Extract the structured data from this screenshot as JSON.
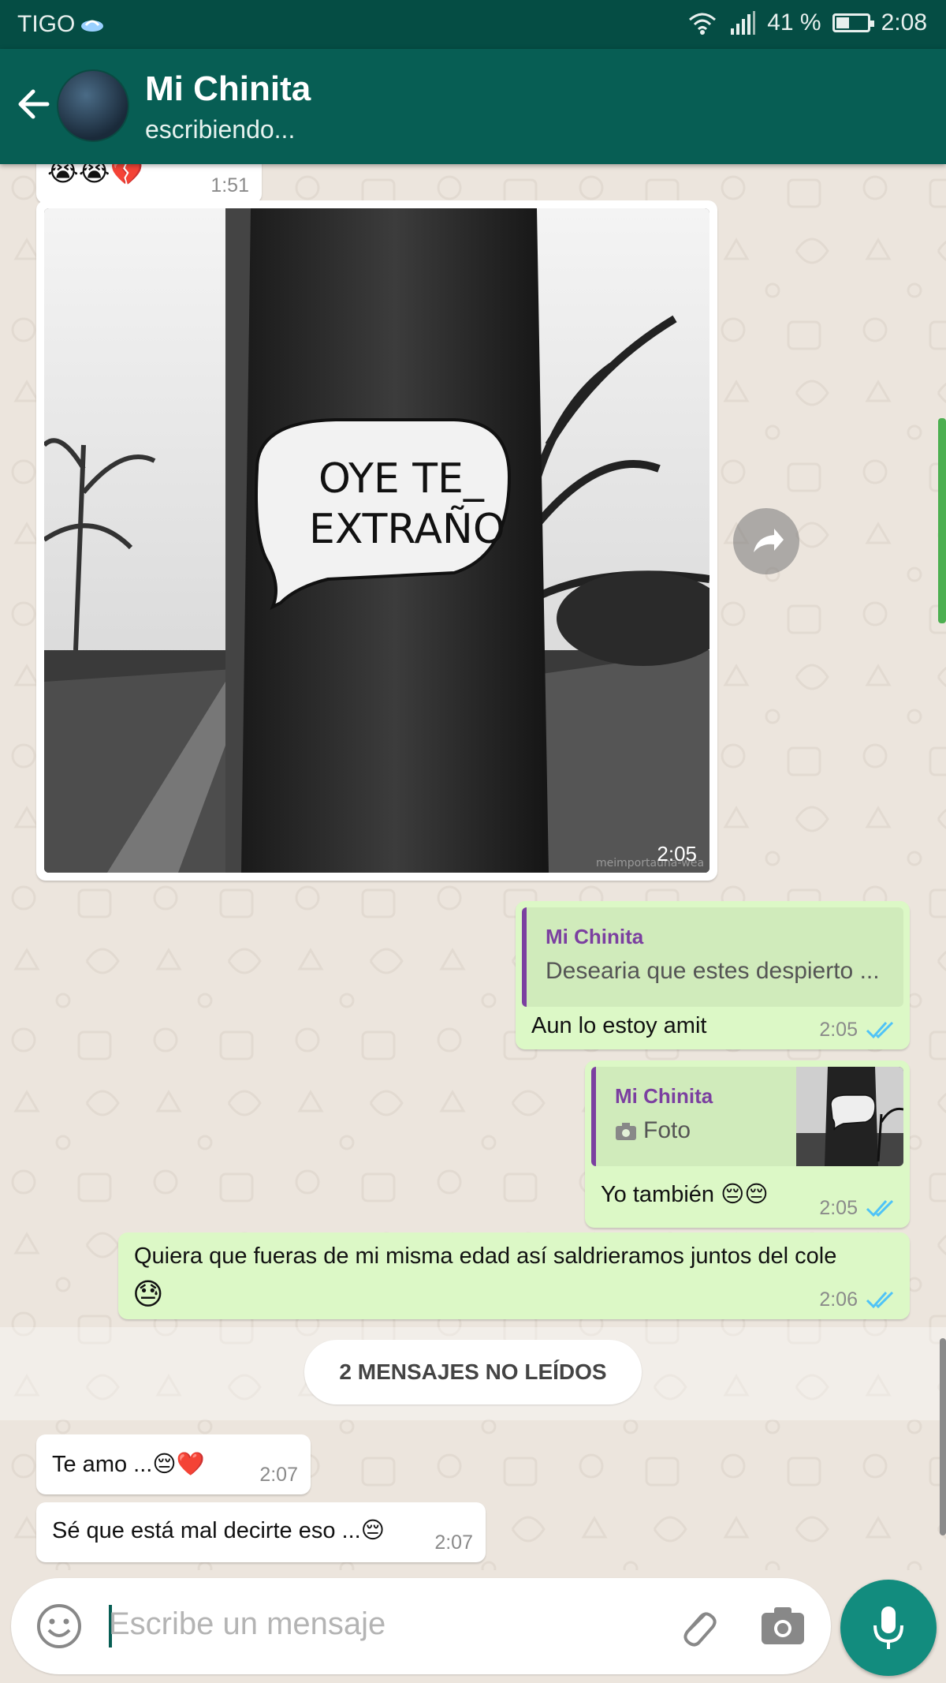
{
  "status_bar": {
    "carrier": "TIGO",
    "battery": "41 %",
    "time": "2:08"
  },
  "header": {
    "title": "Mi Chinita",
    "subtitle": "escribiendo..."
  },
  "messages": [
    {
      "id": "m1",
      "direction": "incoming",
      "content": "emoji",
      "time": "1:51"
    },
    {
      "id": "m2",
      "direction": "incoming",
      "content": "photo",
      "photo_text": "OYE TE_\nEXTRAÑO",
      "watermark": "meimportauna-wea",
      "time": "2:05"
    },
    {
      "id": "m3",
      "direction": "outgoing",
      "quote_name": "Mi Chinita",
      "quote_text": "Desearia que estes despierto ...",
      "text": "Aun lo estoy amit",
      "time": "2:05",
      "read": true
    },
    {
      "id": "m4",
      "direction": "outgoing",
      "quote_name": "Mi Chinita",
      "quote_text": "Foto",
      "text": "Yo también 😔😔",
      "time": "2:05",
      "read": true
    },
    {
      "id": "m5",
      "direction": "outgoing",
      "text": "Quiera que fueras de mi misma edad así saldrieramos juntos del cole",
      "emoji": "😓",
      "time": "2:06",
      "read": true
    },
    {
      "id": "m6",
      "direction": "incoming",
      "text": "Te amo ...😔❤️",
      "time": "2:07"
    },
    {
      "id": "m7",
      "direction": "incoming",
      "text": "Sé que está mal decirte eso ...😔",
      "time": "2:07"
    }
  ],
  "unread_label": "2 MENSAJES NO LEÍDOS",
  "input": {
    "placeholder": "Escribe un mensaje"
  },
  "colors": {
    "header": "#075e54",
    "status_bar": "#054d44",
    "outgoing": "#dcf8c6",
    "incoming": "#ffffff",
    "read_ticks": "#4fc3f7",
    "accent": "#128c7e",
    "quote_name": "#7b3fa0"
  },
  "icons": [
    "back-arrow-icon",
    "wifi-icon",
    "signal-icon",
    "battery-icon",
    "forward-icon",
    "camera-icon",
    "emoji-icon",
    "attach-icon",
    "mic-icon",
    "double-check-icon"
  ]
}
